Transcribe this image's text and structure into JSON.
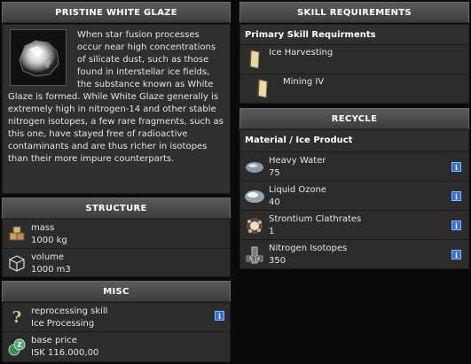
{
  "description": {
    "title": "PRISTINE WHITE GLAZE",
    "image_icon": "white-glaze-ice-icon",
    "text": "When star fusion processes occur near high concentrations of silicate dust, such as those found in interstellar ice fields, the substance known as White Glaze is formed. While White Glaze generally is extremely high in nitrogen-14 and other stable nitrogen isotopes, a few rare fragments, such as this one, have stayed free of radioactive contaminants and are thus richer in isotopes than their more impure counterparts."
  },
  "structure": {
    "title": "STRUCTURE",
    "rows": [
      {
        "label": "mass",
        "value": "1000 kg",
        "icon": "mass-icon"
      },
      {
        "label": "volume",
        "value": "1000 m3",
        "icon": "volume-cube-icon"
      }
    ]
  },
  "misc": {
    "title": "MISC",
    "rows": [
      {
        "label": "reprocessing skill",
        "value": "Ice Processing",
        "icon": "question-mark-icon"
      },
      {
        "label": "base price",
        "value": "ISK 116.000,00",
        "icon": "isk-price-icon"
      }
    ]
  },
  "skills": {
    "title": "SKILL REQUIREMENTS",
    "subtitle": "Primary Skill Requirments",
    "items": [
      {
        "name": "Ice Harvesting",
        "icon": "skillbook-icon"
      },
      {
        "name": "Mining IV",
        "icon": "skillbook-icon"
      }
    ]
  },
  "recycle": {
    "title": "RECYCLE",
    "subtitle": "Material / Ice Product",
    "items": [
      {
        "name": "Heavy Water",
        "qty": "75",
        "icon": "heavy-water-icon"
      },
      {
        "name": "Liquid Ozone",
        "qty": "40",
        "icon": "liquid-ozone-icon"
      },
      {
        "name": "Strontium Clathrates",
        "qty": "1",
        "icon": "strontium-clathrates-icon"
      },
      {
        "name": "Nitrogen Isotopes",
        "qty": "350",
        "icon": "nitrogen-isotopes-icon"
      }
    ]
  },
  "colors": {
    "background": "#0a0a0a",
    "panel": "#2f2f2f",
    "header": "#4a4a4a",
    "info_button": "#2e6fd8"
  }
}
